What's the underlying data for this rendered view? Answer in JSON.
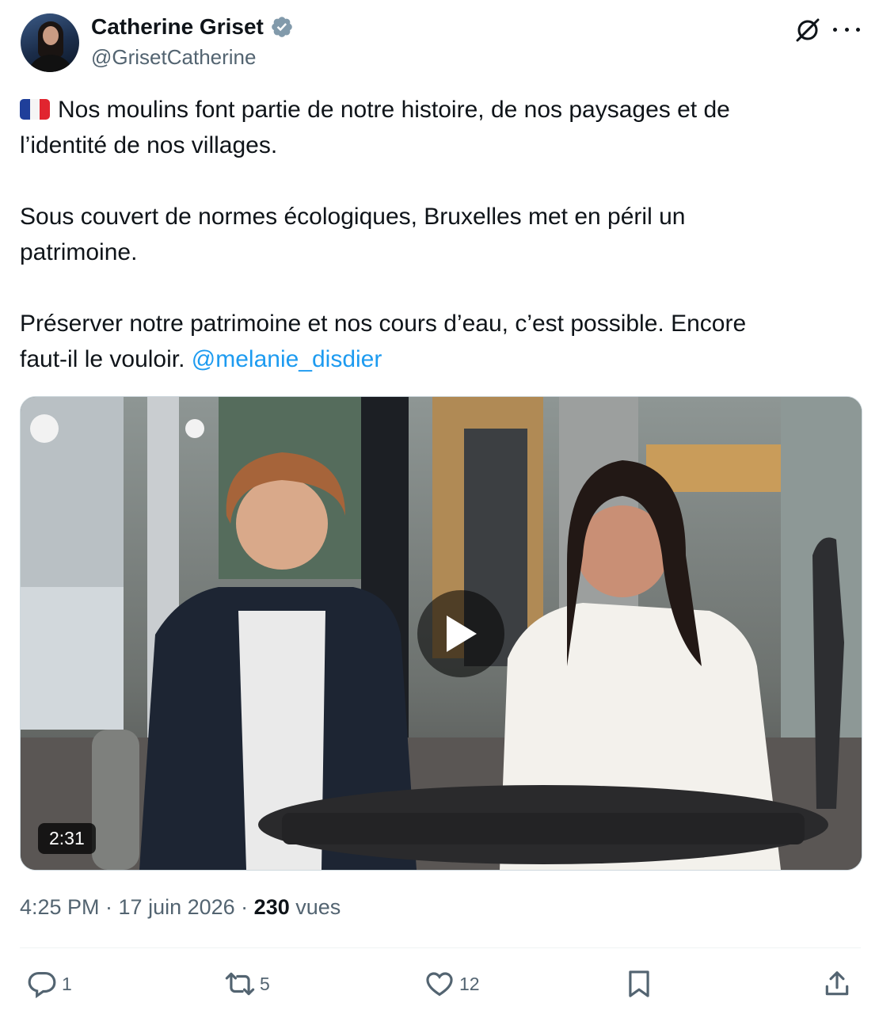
{
  "author": {
    "name": "Catherine Griset",
    "handle": "@GrisetCatherine",
    "verified_color": "#829aab"
  },
  "tweet": {
    "line1": "Nos moulins font partie de notre histoire, de nos paysages et de\nl’identité de nos villages.\n\nSous couvert de normes écologiques, Bruxelles met en péril un\npatrimoine.\n\nPréserver notre patrimoine et nos cours d’eau, c’est possible. Encore\nfaut-il le vouloir. ",
    "mention": "@melanie_disdier",
    "flag": "french-flag"
  },
  "media": {
    "duration": "2:31",
    "play_icon": "play-icon"
  },
  "meta": {
    "time_date": "4:25 PM · 17 juin 2026 · ",
    "views_count": "230",
    "views_label": " vues"
  },
  "actions": {
    "replies": "1",
    "reposts": "5",
    "likes": "12"
  },
  "colors": {
    "accent": "#1d9bf0",
    "muted": "#536471",
    "text": "#0f1419"
  }
}
